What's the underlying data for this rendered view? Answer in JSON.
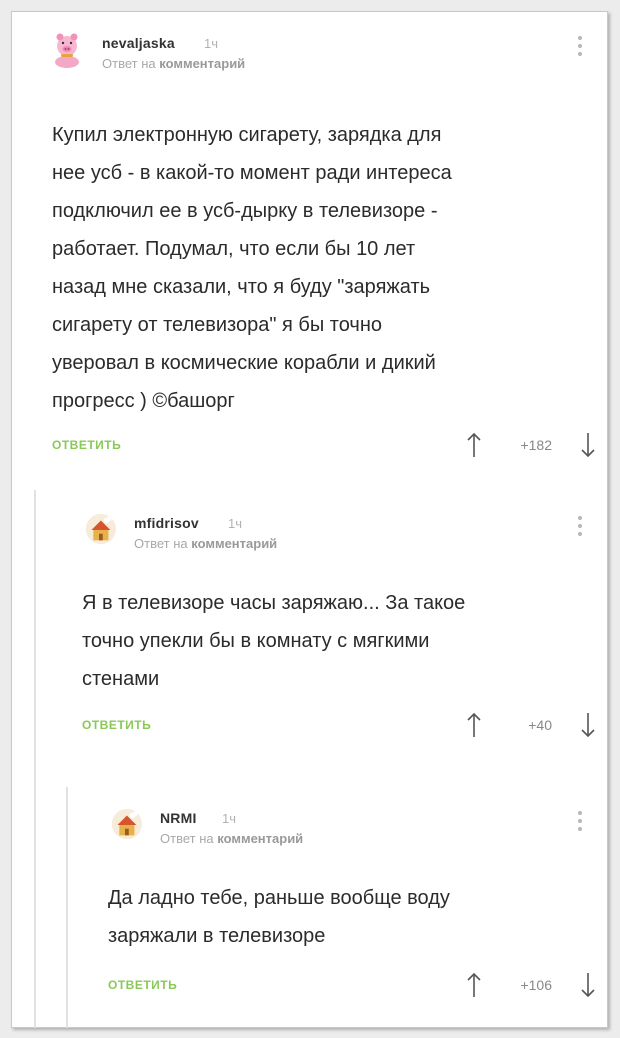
{
  "colors": {
    "reply_link": "#8ac858",
    "muted": "#a8a8a8",
    "card_bg": "#ffffff"
  },
  "comments": [
    {
      "username": "nevaljaska",
      "time": "1ч",
      "reply_prefix": "Ответ на",
      "reply_target": "комментарий",
      "avatar_icon": "pig-avatar-icon",
      "text": "Купил электронную сигарету, зарядка для\nнее усб - в какой-то момент ради интереса\nподключил ее в усб-дырку в телевизоре -\nработает. Подумал, что если бы 10 лет\nназад мне сказали, что я буду \"заряжать\nсигарету от телевизора\" я бы точно\nуверовал в космические корабли и дикий\nпрогресс ) ©башорг",
      "reply_label": "ОТВЕТИТЬ",
      "rating": "+182"
    },
    {
      "username": "mfidrisov",
      "time": "1ч",
      "reply_prefix": "Ответ на",
      "reply_target": "комментарий",
      "avatar_icon": "house-avatar-icon",
      "text": "Я в телевизоре часы заряжаю... За такое\nточно упекли бы в комнату с мягкими\nстенами",
      "reply_label": "ОТВЕТИТЬ",
      "rating": "+40"
    },
    {
      "username": "NRMI",
      "time": "1ч",
      "reply_prefix": "Ответ на",
      "reply_target": "комментарий",
      "avatar_icon": "house-avatar-icon",
      "text": "Да ладно тебе, раньше вообще воду\nзаряжали в телевизоре",
      "reply_label": "ОТВЕТИТЬ",
      "rating": "+106"
    }
  ]
}
